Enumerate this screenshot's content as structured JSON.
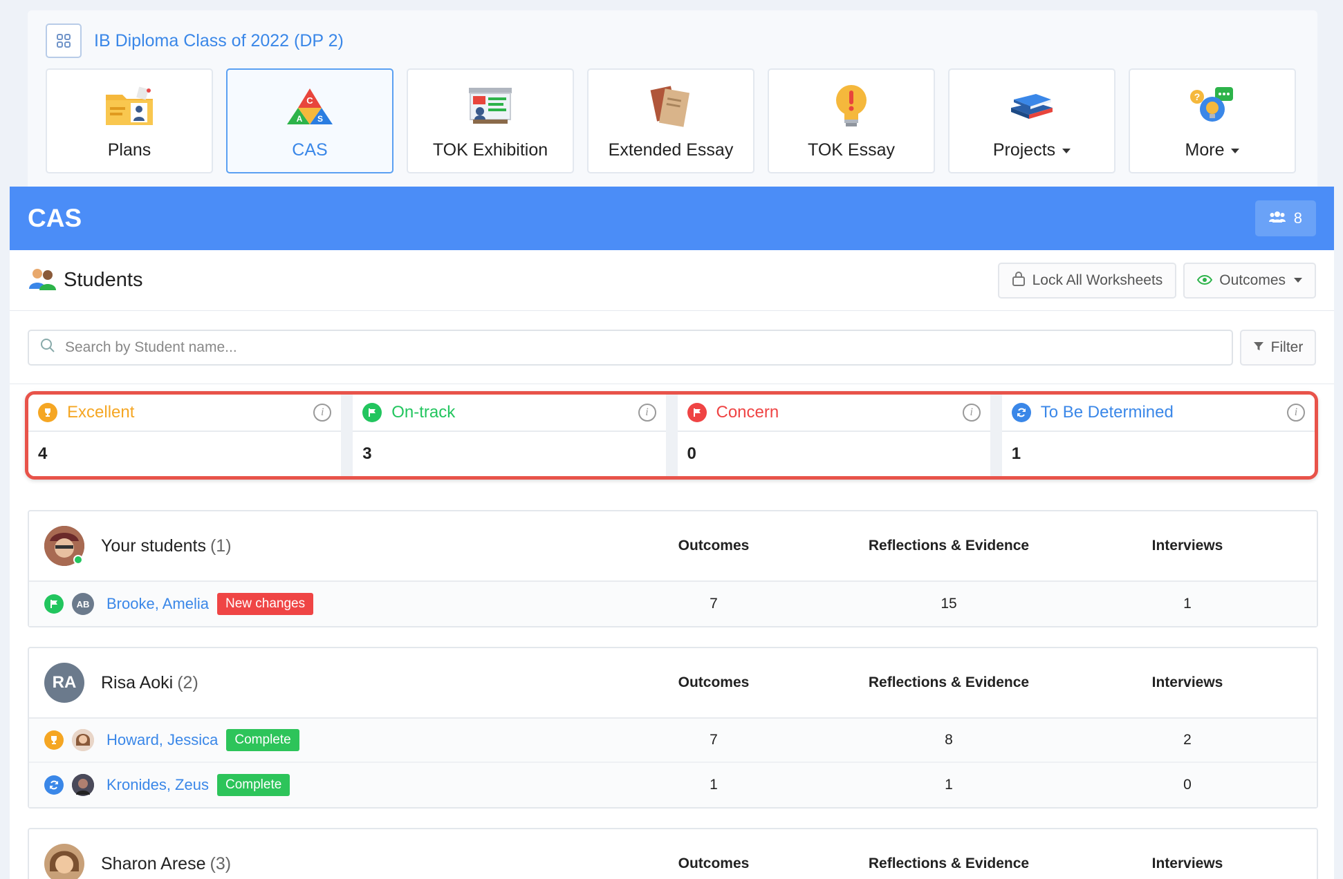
{
  "class_title": "IB Diploma Class of 2022 (DP 2)",
  "tiles": [
    {
      "label": "Plans"
    },
    {
      "label": "CAS"
    },
    {
      "label": "TOK Exhibition"
    },
    {
      "label": "Extended Essay"
    },
    {
      "label": "TOK Essay"
    },
    {
      "label": "Projects"
    },
    {
      "label": "More"
    }
  ],
  "header": {
    "title": "CAS",
    "member_count": "8"
  },
  "students_bar": {
    "title": "Students",
    "lock_label": "Lock All Worksheets",
    "outcomes_label": "Outcomes"
  },
  "search": {
    "placeholder": "Search by Student name...",
    "filter_label": "Filter"
  },
  "statuses": [
    {
      "name": "Excellent",
      "value": "4",
      "color": "#f5a623"
    },
    {
      "name": "On-track",
      "value": "3",
      "color": "#22c55e"
    },
    {
      "name": "Concern",
      "value": "0",
      "color": "#ef4444"
    },
    {
      "name": "To Be Determined",
      "value": "1",
      "color": "#3a87e8"
    }
  ],
  "columns": {
    "outcomes": "Outcomes",
    "reflections": "Reflections & Evidence",
    "interviews": "Interviews"
  },
  "groups": [
    {
      "name": "Your students",
      "count": "(1)",
      "students": [
        {
          "name": "Brooke, Amelia",
          "initials": "AB",
          "badge": "New changes",
          "outcomes": "7",
          "reflections": "15",
          "interviews": "1"
        }
      ]
    },
    {
      "name": "Risa Aoki",
      "initials": "RA",
      "count": "(2)",
      "students": [
        {
          "name": "Howard, Jessica",
          "badge": "Complete",
          "outcomes": "7",
          "reflections": "8",
          "interviews": "2"
        },
        {
          "name": "Kronides, Zeus",
          "badge": "Complete",
          "outcomes": "1",
          "reflections": "1",
          "interviews": "0"
        }
      ]
    },
    {
      "name": "Sharon Arese",
      "count": "(3)",
      "students": []
    }
  ]
}
